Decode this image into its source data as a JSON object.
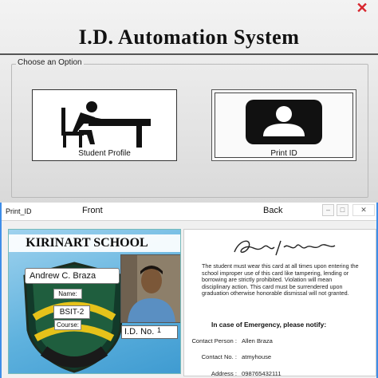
{
  "main": {
    "title": "I.D. Automation System",
    "group_label": "Choose an Option",
    "close_glyph": "✕",
    "buttons": {
      "student_profile": {
        "label": "Student Profile",
        "icon": "student-desk-icon"
      },
      "print_id": {
        "label": "Print ID",
        "icon": "id-card-icon"
      }
    }
  },
  "print_window": {
    "title": "Print_ID",
    "front_label": "Front",
    "back_label": "Back",
    "controls": {
      "minimize": "–",
      "maximize": "□",
      "close": "✕"
    },
    "front": {
      "school_name": "KIRINART SCHOOL",
      "student_name": "Andrew    C. Braza",
      "name_label": "Name:",
      "course": "BSIT-2",
      "course_label": "Course:",
      "id_label": "I.D. No.",
      "id_number": "1"
    },
    "back": {
      "signature": "Richard Nifon",
      "rules": "The student must wear this card at all times upon entering the school improper use of this card like tampering, lending or borrowing are strictly prohibited. Violation will mean disciplinary action. This card must be surrendered upon graduation otherwise honorable dismissal will not granted.",
      "emergency_label": "In case of Emergency, please notify:",
      "contact_person_label": "Contact Person :",
      "contact_person": "Allen Braza",
      "contact_no_label": "Contact No. :",
      "contact_no": "atmyhouse",
      "address_label": "Address :",
      "address": "098765432111"
    }
  },
  "colors": {
    "close_red": "#d8262e",
    "window_border": "#3e8de8",
    "card_blue": "#5fb2de"
  }
}
